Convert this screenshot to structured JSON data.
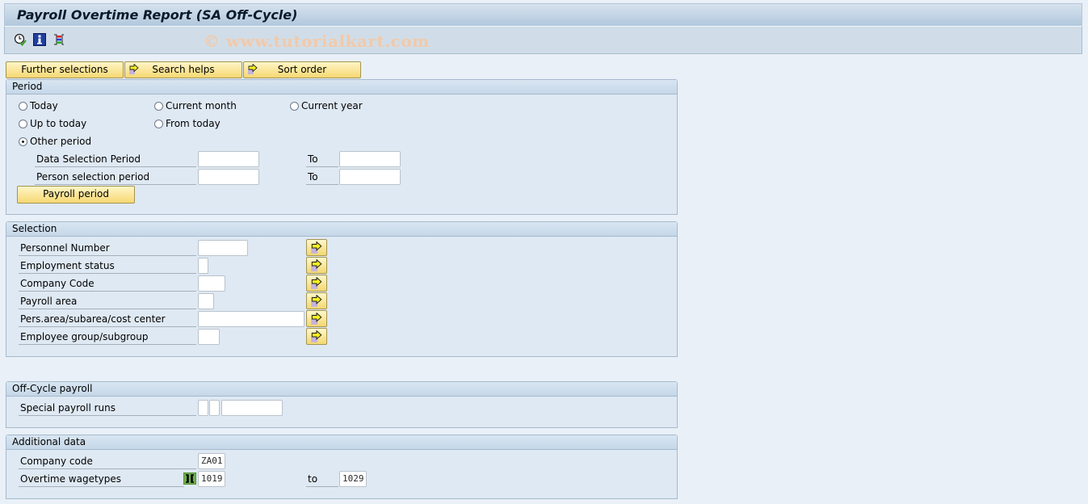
{
  "title": "Payroll Overtime Report (SA Off-Cycle)",
  "watermark": "© www.tutorialkart.com",
  "toolbar": {
    "icons": [
      "execute-clock-icon",
      "info-icon",
      "selection-options-icon"
    ]
  },
  "buttons": {
    "further_selections": "Further selections",
    "search_helps": "Search helps",
    "sort_order": "Sort order"
  },
  "period": {
    "title": "Period",
    "radios": [
      {
        "label": "Today",
        "selected": false
      },
      {
        "label": "Current month",
        "selected": false
      },
      {
        "label": "Current year",
        "selected": false
      },
      {
        "label": "Up to today",
        "selected": false
      },
      {
        "label": "From today",
        "selected": false
      },
      {
        "label": "Other period",
        "selected": true
      }
    ],
    "data_selection_label": "Data Selection Period",
    "person_selection_label": "Person selection period",
    "to_label": "To",
    "data_from": "",
    "data_to": "",
    "person_from": "",
    "person_to": "",
    "payroll_period_button": "Payroll period"
  },
  "selection": {
    "title": "Selection",
    "fields": [
      {
        "label": "Personnel Number",
        "value": ""
      },
      {
        "label": "Employment status",
        "value": ""
      },
      {
        "label": "Company Code",
        "value": ""
      },
      {
        "label": "Payroll area",
        "value": ""
      },
      {
        "label": "Pers.area/subarea/cost center",
        "value": ""
      },
      {
        "label": "Employee group/subgroup",
        "value": ""
      }
    ]
  },
  "offcycle": {
    "title": "Off-Cycle payroll",
    "special_runs_label": "Special payroll runs",
    "values": [
      "",
      "",
      ""
    ]
  },
  "additional": {
    "title": "Additional data",
    "company_code_label": "Company code",
    "company_code_value": "ZA01",
    "wagetypes_label": "Overtime wagetypes",
    "wagetypes_from": "1019",
    "to_label": "to",
    "wagetypes_to": "1029"
  }
}
